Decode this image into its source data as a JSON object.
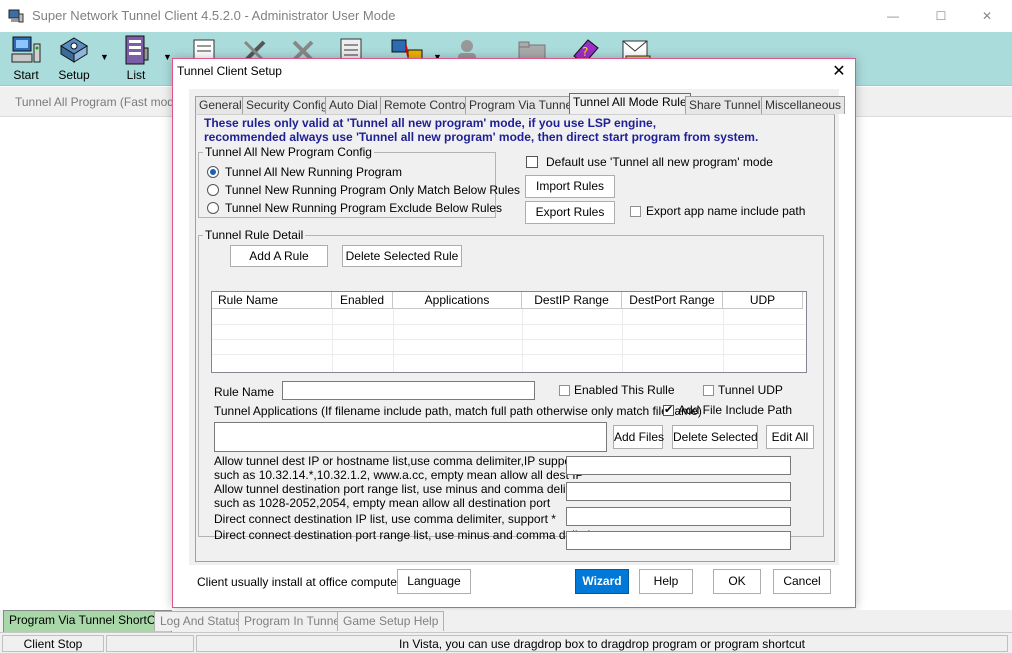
{
  "window": {
    "title": "Super Network Tunnel Client 4.5.2.0 - Administrator User Mode",
    "controls": {
      "minimize": "—",
      "maximize": "☐",
      "close": "✕"
    }
  },
  "toolbar": {
    "start_label": "Start",
    "setup_label": "Setup",
    "list_label": "List",
    "dropdown_glyph": "▼"
  },
  "info_line": "Tunnel All Program (Fast mode, e",
  "dialog": {
    "title": "Tunnel Client Setup",
    "close_glyph": "✕",
    "tabs": [
      {
        "label": "General"
      },
      {
        "label": "Security Config"
      },
      {
        "label": "Auto Dial"
      },
      {
        "label": "Remote Control"
      },
      {
        "label": "Program Via Tunnel"
      },
      {
        "label": "Tunnel All Mode Rule"
      },
      {
        "label": "Share Tunnel"
      },
      {
        "label": "Miscellaneous"
      }
    ],
    "active_tab": "Tunnel All Mode Rule",
    "notice_line1": "These rules only valid at 'Tunnel all new program' mode, if you use LSP engine,",
    "notice_line2": "recommended always use 'Tunnel all new program' mode, then direct start program from system.",
    "program_config": {
      "title": "Tunnel All New Program Config",
      "options": [
        {
          "label": "Tunnel All New Running Program",
          "selected": true
        },
        {
          "label": "Tunnel New Running Program Only Match Below Rules",
          "selected": false
        },
        {
          "label": "Tunnel New Running Program Exclude Below Rules",
          "selected": false
        }
      ]
    },
    "default_mode_label": "Default use 'Tunnel all new program' mode",
    "default_mode_checked": false,
    "import_rules_label": "Import Rules",
    "export_rules_label": "Export Rules",
    "export_path_label": "Export app name include path",
    "export_path_checked": false,
    "rule_detail": {
      "title": "Tunnel Rule Detail",
      "add_rule_label": "Add A Rule",
      "delete_rule_label": "Delete Selected Rule",
      "columns": [
        "Rule Name",
        "Enabled",
        "Applications",
        "DestIP Range",
        "DestPort Range",
        "UDP"
      ],
      "rows": [],
      "rule_name_label": "Rule Name",
      "rule_name_value": "",
      "enabled_rule_label": "Enabled This Rulle",
      "enabled_rule_checked": false,
      "tunnel_udp_label": "Tunnel UDP",
      "tunnel_udp_checked": false,
      "apps_label": "Tunnel Applications (If filename include path, match full path otherwise only match filename)",
      "add_include_path_label": "Add File Include Path",
      "add_include_path_checked": true,
      "apps_value": "",
      "add_files_label": "Add Files",
      "delete_selected_label": "Delete Selected",
      "edit_all_label": "Edit All",
      "dest_ip_label1": "Allow tunnel dest IP or hostname list,use comma delimiter,IP support *,",
      "dest_ip_label2": "such as 10.32.14.*,10.32.1.2, www.a.cc, empty mean allow all dest IP",
      "dest_ip_value": "",
      "dest_port_label1": "Allow tunnel destination port range list, use minus and comma delimiter",
      "dest_port_label2": "such as 1028-2052,2054, empty mean allow all destination port",
      "dest_port_value": "",
      "direct_ip_label": "Direct connect destination IP list, use comma delimiter, support *",
      "direct_ip_value": "",
      "direct_port_label": "Direct connect destination port range list, use minus and comma delimiter",
      "direct_port_value": ""
    },
    "footer": {
      "note": "Client usually install at office computer.",
      "language_label": "Language",
      "wizard_label": "Wizard",
      "help_label": "Help",
      "ok_label": "OK",
      "cancel_label": "Cancel"
    }
  },
  "bottom_tabs": [
    {
      "label": "Program Via Tunnel ShortCut"
    },
    {
      "label": "Log And Status"
    },
    {
      "label": "Program In Tunnel"
    },
    {
      "label": "Game Setup Help"
    }
  ],
  "status_bar": {
    "left": "Client Stop",
    "middle": "",
    "message": "In Vista, you can use dragdrop box to dragdrop program or program shortcut"
  },
  "colors": {
    "toolbar_bg": "#abdcdc",
    "dialog_border": "#e0548a",
    "notice_text": "#1e1e96",
    "wizard_bg": "#0078d7",
    "active_bottom_tab": "#a8d8a8"
  }
}
